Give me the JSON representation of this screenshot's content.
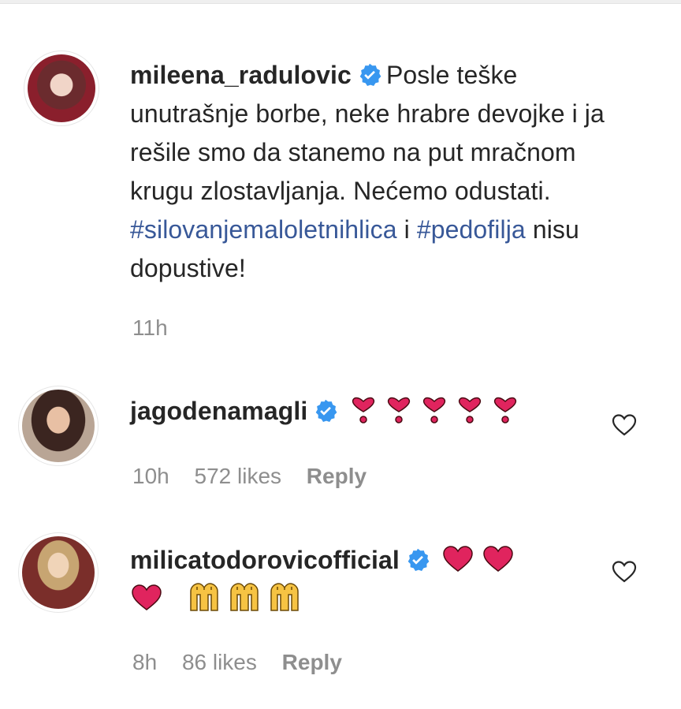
{
  "comments": [
    {
      "username": "mileena_radulovic",
      "text_part1": "Posle teške unutrašnje borbe, neke hrabre devojke i ja rešile smo da stanemo na put mračnom krugu zlostavljanja. Nećemo odustati.",
      "hashtag1": "#silovanjemaloletnihlica",
      "connector": "i",
      "hashtag2": "#pedofilja",
      "text_part2": "nisu dopustive!",
      "time": "11h"
    },
    {
      "username": "jagodenamagli",
      "emoji": "heavy-heart-exclamation x5",
      "time": "10h",
      "likes": "572 likes",
      "reply": "Reply"
    },
    {
      "username": "milicatodorovicofficial",
      "emoji": "red-heart x3, raising-hands x3",
      "time": "8h",
      "likes": "86 likes",
      "reply": "Reply"
    }
  ],
  "colors": {
    "text": "#262626",
    "meta": "#8e8e8e",
    "hashtag": "#385898",
    "verified": "#3897f0",
    "heart": "#e0245e"
  },
  "icons": [
    "verified-badge-icon",
    "heart-outline-icon",
    "heart-exclamation-emoji",
    "red-heart-emoji",
    "raising-hands-emoji"
  ]
}
